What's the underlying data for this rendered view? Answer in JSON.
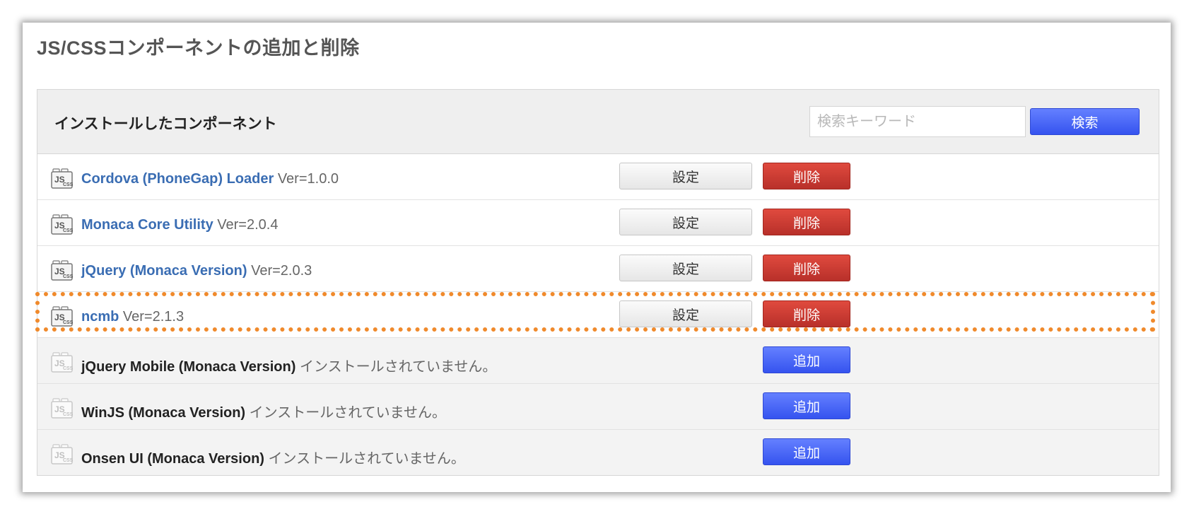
{
  "page": {
    "title": "JS/CSSコンポーネントの追加と削除"
  },
  "panel": {
    "title": "インストールしたコンポーネント",
    "search_placeholder": "検索キーワード",
    "search_button": "検索"
  },
  "components": [
    {
      "name": "Cordova (PhoneGap) Loader",
      "version": "Ver=1.0.0",
      "installed": true,
      "settings_label": "設定",
      "delete_label": "削除"
    },
    {
      "name": "Monaca Core Utility",
      "version": "Ver=2.0.4",
      "installed": true,
      "settings_label": "設定",
      "delete_label": "削除"
    },
    {
      "name": "jQuery (Monaca Version)",
      "version": "Ver=2.0.3",
      "installed": true,
      "settings_label": "設定",
      "delete_label": "削除"
    },
    {
      "name": "ncmb",
      "version": "Ver=2.1.3",
      "installed": true,
      "settings_label": "設定",
      "delete_label": "削除",
      "highlighted": true
    },
    {
      "name": "jQuery Mobile (Monaca Version)",
      "status": "インストールされていません。",
      "installed": false,
      "add_label": "追加"
    },
    {
      "name": "WinJS (Monaca Version)",
      "status": "インストールされていません。",
      "installed": false,
      "add_label": "追加"
    },
    {
      "name": "Onsen UI (Monaca Version)",
      "status": "インストールされていません。",
      "installed": false,
      "add_label": "追加"
    }
  ],
  "icons": {
    "component": "js-css-icon"
  },
  "colors": {
    "link": "#3a6db3",
    "delete": "#c8392f",
    "primary": "#4464f7",
    "highlight": "#f08a2c"
  }
}
